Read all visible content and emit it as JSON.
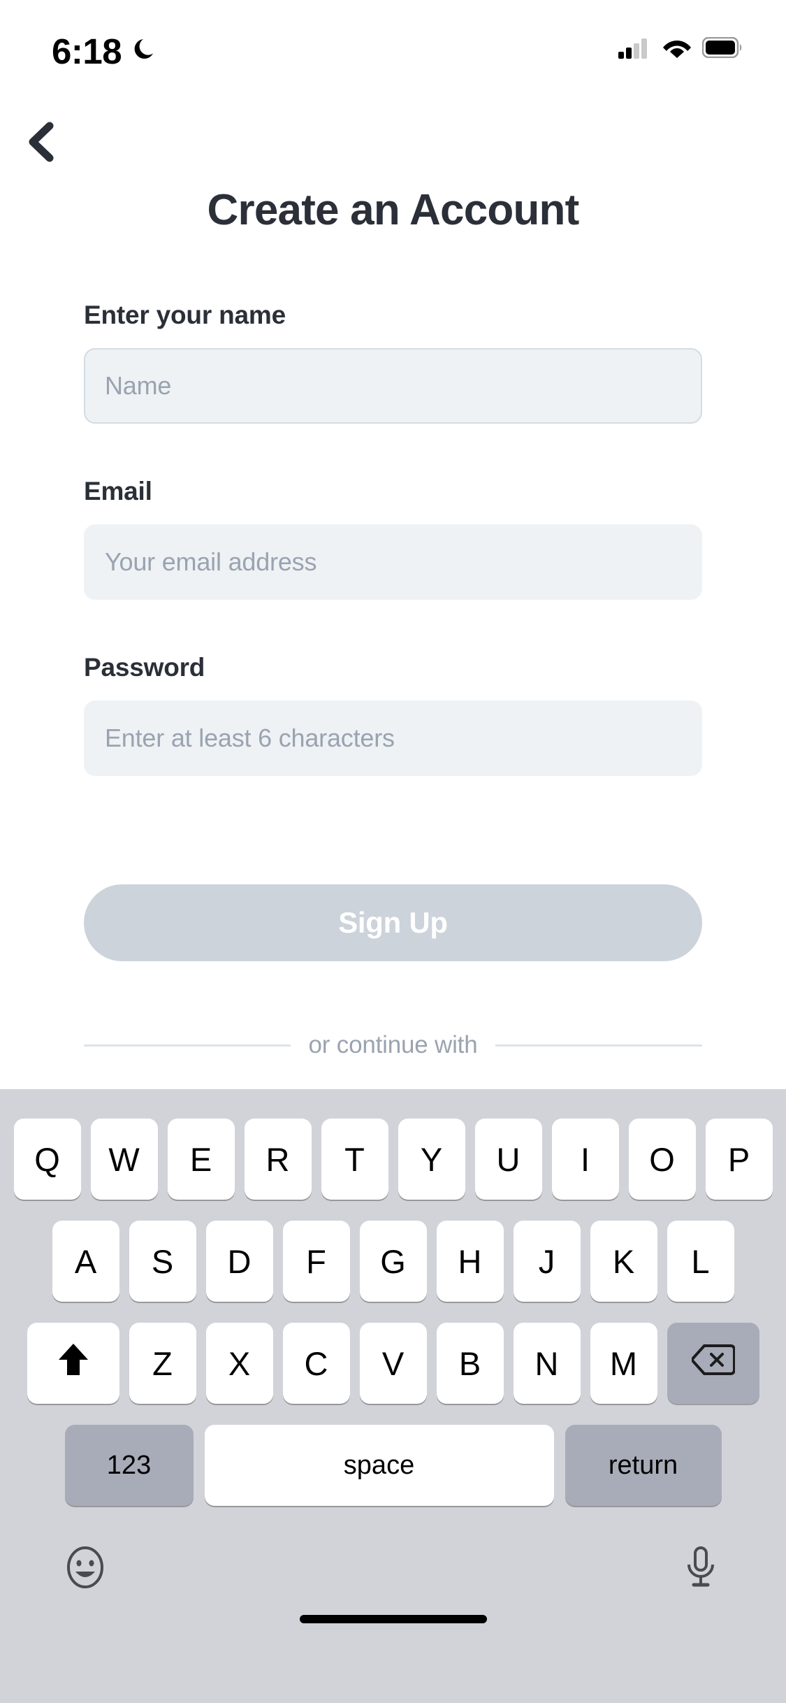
{
  "status_bar": {
    "time": "6:18",
    "dnd_icon": "crescent-moon-icon",
    "cellular_icon": "cellular-signal-icon",
    "wifi_icon": "wifi-icon",
    "battery_icon": "battery-icon"
  },
  "nav": {
    "back_icon": "chevron-left-icon"
  },
  "header": {
    "title": "Create an Account"
  },
  "form": {
    "fields": [
      {
        "label": "Enter your name",
        "placeholder": "Name",
        "value": "",
        "focused": true,
        "name": "name"
      },
      {
        "label": "Email",
        "placeholder": "Your email address",
        "value": "",
        "focused": false,
        "name": "email"
      },
      {
        "label": "Password",
        "placeholder": "Enter at least 6 characters",
        "value": "",
        "focused": false,
        "name": "password"
      }
    ]
  },
  "actions": {
    "signup_label": "Sign Up",
    "signup_disabled": true,
    "signup_bg": "#ccd3da",
    "signup_text_color": "#ffffff"
  },
  "divider": {
    "text": "or continue with"
  },
  "keyboard": {
    "background": "#d1d3d9",
    "row1": [
      "Q",
      "W",
      "E",
      "R",
      "T",
      "Y",
      "U",
      "I",
      "O",
      "P"
    ],
    "row2": [
      "A",
      "S",
      "D",
      "F",
      "G",
      "H",
      "J",
      "K",
      "L"
    ],
    "row3": [
      "Z",
      "X",
      "C",
      "V",
      "B",
      "N",
      "M"
    ],
    "shift_icon": "shift-arrow-icon",
    "delete_icon": "backspace-delete-icon",
    "numbers_label": "123",
    "space_label": "space",
    "return_label": "return",
    "emoji_icon": "emoji-smiley-icon",
    "mic_icon": "microphone-icon"
  },
  "colors": {
    "field_bg": "#eff2f5",
    "field_border_focused": "#d3dbe2",
    "placeholder": "#9aa3b0",
    "text_dark": "#2b2f38",
    "key_white": "#ffffff",
    "key_gray": "#a8acb8"
  }
}
